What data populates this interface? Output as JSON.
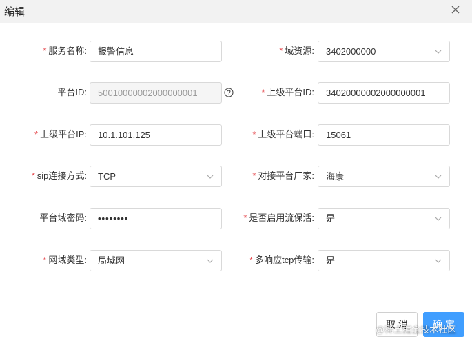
{
  "dialog": {
    "title": "编辑",
    "close_icon": "close-icon"
  },
  "form": {
    "required_mark": "*",
    "service_name": {
      "label": "服务名称:",
      "value": "报警信息",
      "required": true
    },
    "domain_resource": {
      "label": "域资源:",
      "value": "3402000000",
      "required": true,
      "icon": "chevron-down-icon"
    },
    "platform_id": {
      "label": "平台ID:",
      "value": "50010000002000000001",
      "required": false,
      "disabled": true,
      "help_icon": "question-circle-icon"
    },
    "upper_platform_id": {
      "label": "上级平台ID:",
      "value": "34020000002000000001",
      "required": true
    },
    "upper_platform_ip": {
      "label": "上级平台IP:",
      "value": "10.1.101.125",
      "required": true
    },
    "upper_platform_port": {
      "label": "上级平台端口:",
      "value": "15061",
      "required": true
    },
    "sip_method": {
      "label": "sip连接方式:",
      "value": "TCP",
      "required": true,
      "icon": "chevron-down-icon"
    },
    "vendor": {
      "label": "对接平台厂家:",
      "value": "海康",
      "required": true,
      "icon": "chevron-down-icon"
    },
    "domain_password": {
      "label": "平台域密码:",
      "value": "••••••••",
      "required": false
    },
    "enable_keepalive": {
      "label": "是否启用流保活:",
      "value": "是",
      "required": true,
      "icon": "chevron-down-icon"
    },
    "network_type": {
      "label": "网域类型:",
      "value": "局域网",
      "required": true,
      "icon": "chevron-down-icon"
    },
    "multi_response_tcp": {
      "label": "多响应tcp传输:",
      "value": "是",
      "required": true,
      "icon": "chevron-down-icon"
    }
  },
  "footer": {
    "cancel_label": "取 消",
    "ok_label": "确 定",
    "watermark": "@稀土掘金技术社区"
  },
  "colors": {
    "primary": "#409eff",
    "required": "#e5484d",
    "header_bg": "#f2f2f2"
  }
}
